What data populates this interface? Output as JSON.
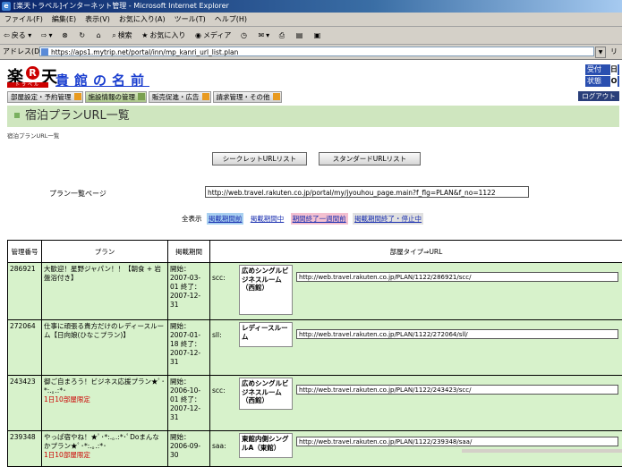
{
  "window": {
    "title": "[楽天トラベル]インターネット管理 - Microsoft Internet Explorer"
  },
  "menu": [
    "ファイル(F)",
    "編集(E)",
    "表示(V)",
    "お気に入り(A)",
    "ツール(T)",
    "ヘルプ(H)"
  ],
  "toolbar": {
    "back": "戻る",
    "search": "検索",
    "favorites": "お気に入り",
    "media": "メディア"
  },
  "address": {
    "label": "アドレス(D)",
    "url": "https://aps1.mytrip.net/portal/inn/mp_kanri_url_list.plan",
    "links": "リ"
  },
  "header": {
    "logo_text": "楽",
    "logo_r": "R",
    "logo_text2": "天",
    "logo_sub": "トラベル",
    "hotel_name": "貴館の名前",
    "status": [
      {
        "label": "受付",
        "value": "日"
      },
      {
        "label": "状態",
        "value": "O"
      }
    ],
    "logout": "ログアウト"
  },
  "nav": [
    "部屋設定・予約管理",
    "施設情報の管理",
    "販売促進・広告",
    "請求管理・その他"
  ],
  "page_title": "宿泊プランURL一覧",
  "breadcrumb": "宿泊プランURL一覧",
  "buttons": {
    "secret": "シークレットURLリスト",
    "standard": "スタンダードURLリスト"
  },
  "list_page": {
    "label": "プラン一覧ページ",
    "url": "http://web.travel.rakuten.co.jp/portal/my/jyouhou_page.main?f_flg=PLAN&f_no=1122"
  },
  "filters": {
    "all": "全表示",
    "items": [
      {
        "label": "掲載期間前",
        "bg": "#a8d0f0"
      },
      {
        "label": "掲載期間中",
        "bg": "#ffffff"
      },
      {
        "label": "期間終了一週間前",
        "bg": "#f4c0d0"
      },
      {
        "label": "掲載期間終了・停止中",
        "bg": "#e0e0e0"
      }
    ]
  },
  "table": {
    "headers": [
      "管理番号",
      "プラン",
      "掲載期間",
      "部屋タイプ⇒URL"
    ],
    "rows": [
      {
        "id": "286921",
        "plan": "大歓迎！星野ジャパン！！【朝食 + 岩盤浴付き】",
        "limit": "",
        "period": "開始：2007-03-01 終了：2007-12-31",
        "code": "scc:",
        "room": "広めシングルビジネスルーム（西館）",
        "url": "http://web.travel.rakuten.co.jp/PLAN/1122/286921/scc/"
      },
      {
        "id": "272064",
        "plan": "仕事に頑張る貴方だけのレディースルーム【日向娘(ひなこプラン)】",
        "limit": "",
        "period": "開始：2007-01-18 終了：2007-12-31",
        "code": "sll:",
        "room": "レディースルーム",
        "url": "http://web.travel.rakuten.co.jp/PLAN/1122/272064/sll/"
      },
      {
        "id": "243423",
        "plan": "御ご自まろう！ビジネス応援プラン★ﾟ･*:.｡.:*･",
        "limit": "1日10部屋限定",
        "period": "開始：2006-10-01 終了：2007-12-31",
        "code": "scc:",
        "room": "広めシングルビジネスルーム（西館）",
        "url": "http://web.travel.rakuten.co.jp/PLAN/1122/243423/scc/"
      },
      {
        "id": "239348",
        "plan": "やっぱ宿やね！★ﾟ･*:.｡.:*･ﾟDoまんなかプラン★ﾟ･*:.｡.:*･",
        "limit": "1日10部屋限定",
        "period": "開始：2006-09-30",
        "code": "saa:",
        "room": "東館内側シングルA（東館）",
        "url": "http://web.travel.rakuten.co.jp/PLAN/1122/239348/saa/"
      }
    ]
  }
}
